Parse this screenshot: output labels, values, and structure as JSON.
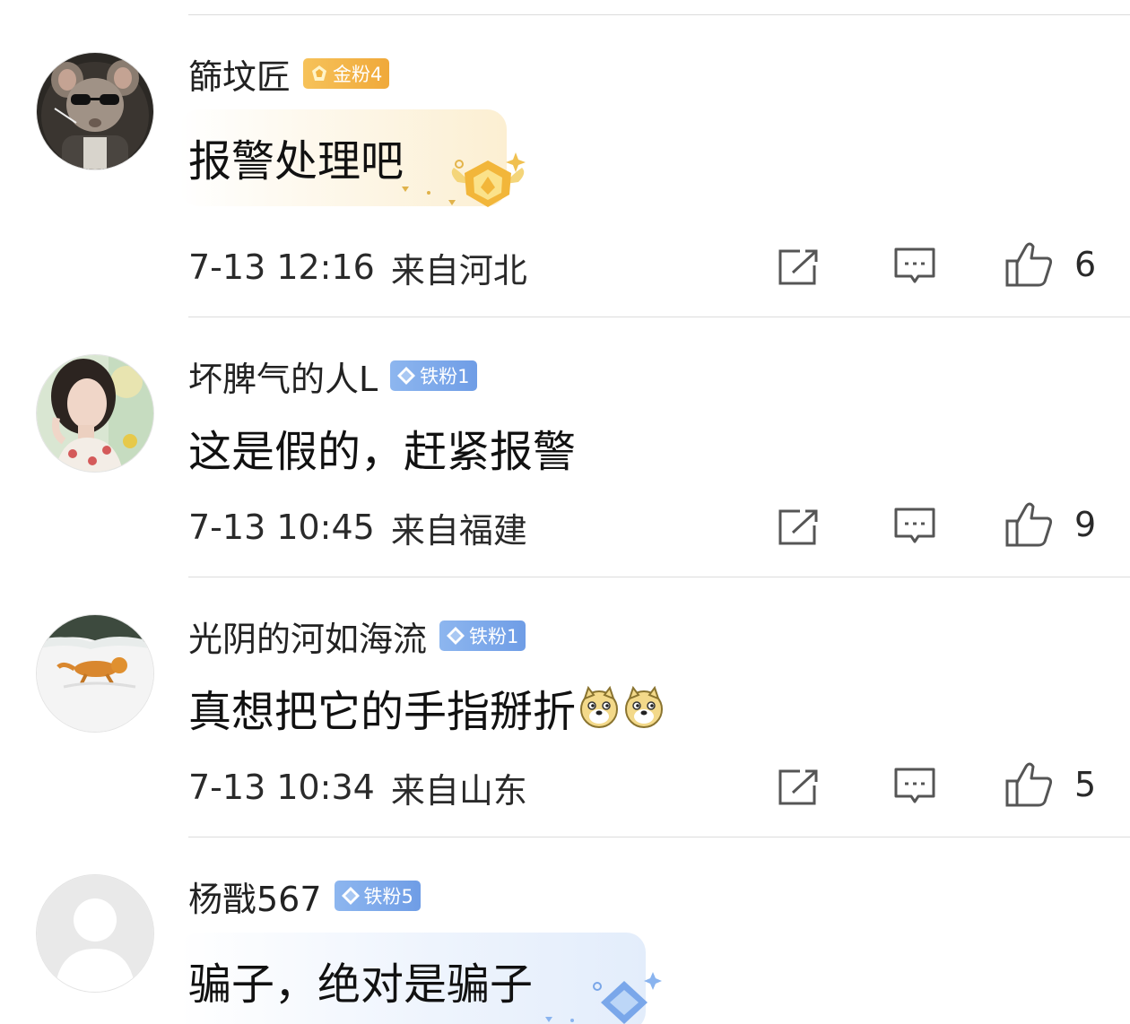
{
  "comments": [
    {
      "username": "篩坟匠",
      "badge": "金粉4",
      "badge_type": "gold",
      "avatar": "mouse-with-sunglasses",
      "text": "报警处理吧",
      "time": "7-13 12:16",
      "location": "来自河北",
      "likes": "6"
    },
    {
      "username": "坏脾气的人L",
      "badge": "铁粉1",
      "badge_type": "iron",
      "avatar": "woman-portrait",
      "text": "这是假的，赶紧报警",
      "time": "7-13 10:45",
      "location": "来自福建",
      "likes": "9"
    },
    {
      "username": "光阴的河如海流",
      "badge": "铁粉1",
      "badge_type": "iron",
      "avatar": "cat-running-in-snow",
      "text": "真想把它的手指掰折",
      "emojis": [
        "doge-emoji",
        "doge-emoji"
      ],
      "time": "7-13 10:34",
      "location": "来自山东",
      "likes": "5"
    },
    {
      "username": "杨戬567",
      "badge": "铁粉5",
      "badge_type": "iron",
      "avatar": "default-user-avatar",
      "text": "骗子，绝对是骗子"
    }
  ],
  "icons": {
    "share": "share-icon",
    "reply": "comment-icon",
    "like": "thumbs-up-icon"
  },
  "colors": {
    "gold_badge": "#f0a93a",
    "iron_badge": "#6f9de6",
    "divider": "#dcdcdc",
    "icon_gray": "#555555"
  }
}
